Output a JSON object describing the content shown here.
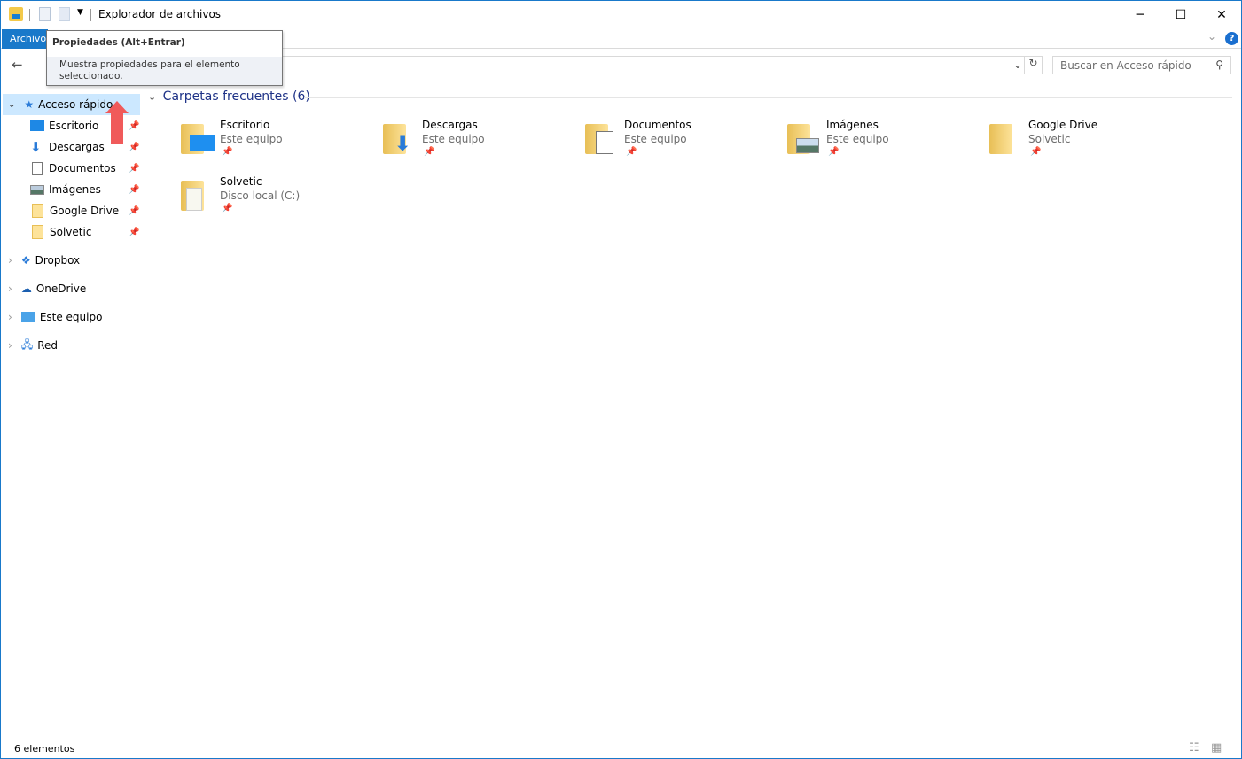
{
  "window": {
    "title": "Explorador de archivos",
    "controls": {
      "minimize": "─",
      "maximize": "☐",
      "close": "✕"
    }
  },
  "ribbon": {
    "archivo": "Archivo",
    "expand": "⌄",
    "help": "?"
  },
  "tooltip": {
    "title": "Propiedades (Alt+Entrar)",
    "body": "Muestra propiedades para el elemento seleccionado."
  },
  "address": {
    "back": "←",
    "forward": "→",
    "dropdown": "⌄",
    "refresh": "↻"
  },
  "search": {
    "placeholder": "Buscar en Acceso rápido",
    "icon": "search-icon"
  },
  "nav": {
    "quick_access": "Acceso rápido",
    "quick_items": [
      {
        "label": "Escritorio",
        "icon": "desktop-icon"
      },
      {
        "label": "Descargas",
        "icon": "download-icon"
      },
      {
        "label": "Documentos",
        "icon": "document-icon"
      },
      {
        "label": "Imágenes",
        "icon": "pictures-icon"
      },
      {
        "label": "Google Drive",
        "icon": "folder-icon"
      },
      {
        "label": "Solvetic",
        "icon": "folder-icon"
      }
    ],
    "roots": [
      {
        "label": "Dropbox",
        "icon": "dropbox-icon"
      },
      {
        "label": "OneDrive",
        "icon": "onedrive-icon"
      },
      {
        "label": "Este equipo",
        "icon": "computer-icon"
      },
      {
        "label": "Red",
        "icon": "network-icon"
      }
    ]
  },
  "main": {
    "group_title": "Carpetas frecuentes (6)",
    "folders": [
      {
        "name": "Escritorio",
        "location": "Este equipo"
      },
      {
        "name": "Descargas",
        "location": "Este equipo"
      },
      {
        "name": "Documentos",
        "location": "Este equipo"
      },
      {
        "name": "Imágenes",
        "location": "Este equipo"
      },
      {
        "name": "Google Drive",
        "location": "Solvetic"
      },
      {
        "name": "Solvetic",
        "location": "Disco local (C:)"
      }
    ]
  },
  "status": {
    "count": "6 elementos"
  },
  "colors": {
    "accent": "#1979ca",
    "selection": "#cce8ff",
    "group_title": "#1e3287"
  }
}
